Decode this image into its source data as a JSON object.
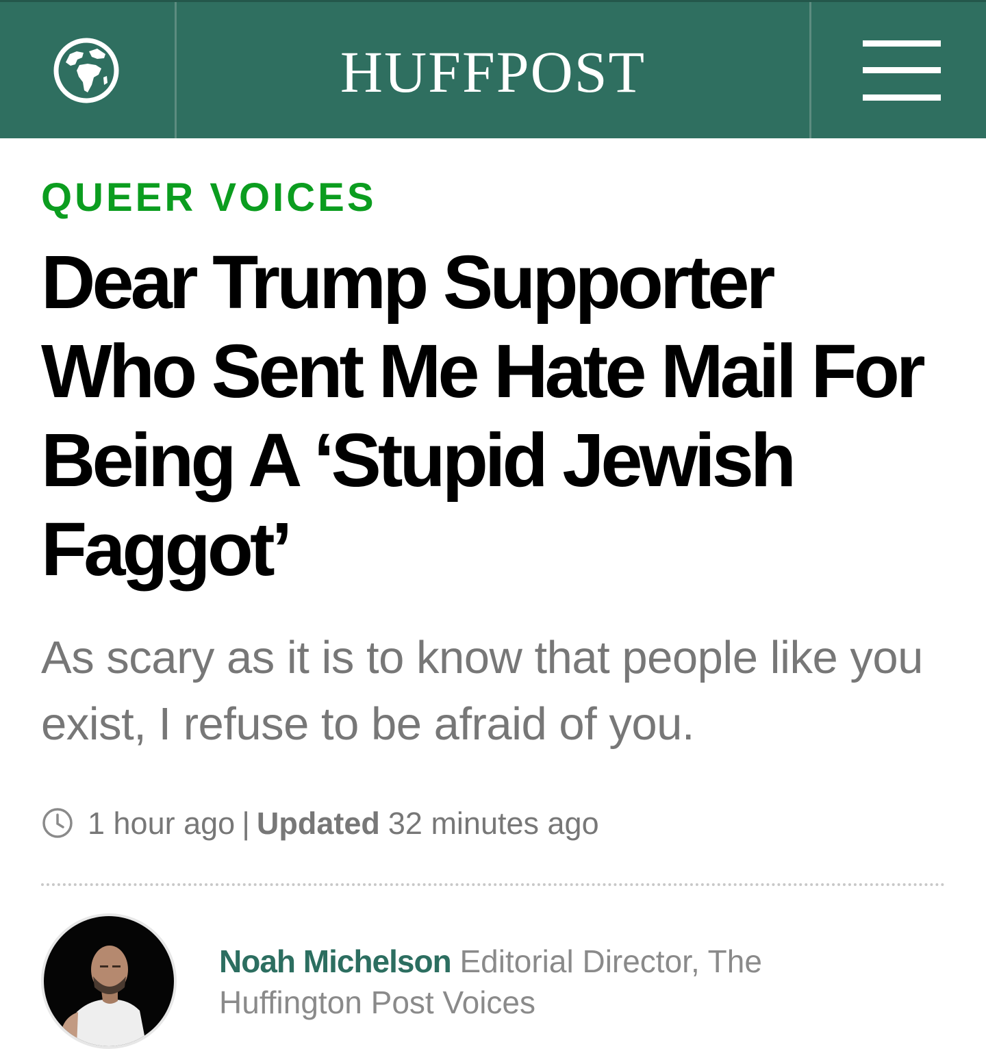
{
  "header": {
    "logo": "HUFFPOST",
    "edition_icon": "globe-icon",
    "menu_icon": "hamburger-menu-icon"
  },
  "article": {
    "section": "QUEER VOICES",
    "headline": "Dear Trump Supporter Who Sent Me Hate Mail For Being A ‘Stupid Jewish Faggot’",
    "dek": "As scary as it is to know that people like you exist, I refuse to be afraid of you.",
    "timestamp": {
      "icon": "clock-icon",
      "published": "1 hour ago",
      "separator": "|",
      "updated_label": "Updated",
      "updated": "32 minutes ago"
    }
  },
  "author": {
    "name": "Noah Michelson",
    "title": "Editorial Director, The Huffington Post Voices"
  },
  "colors": {
    "brand": "#2f6f60",
    "section": "#0b9d1f",
    "author": "#2c6e60"
  }
}
